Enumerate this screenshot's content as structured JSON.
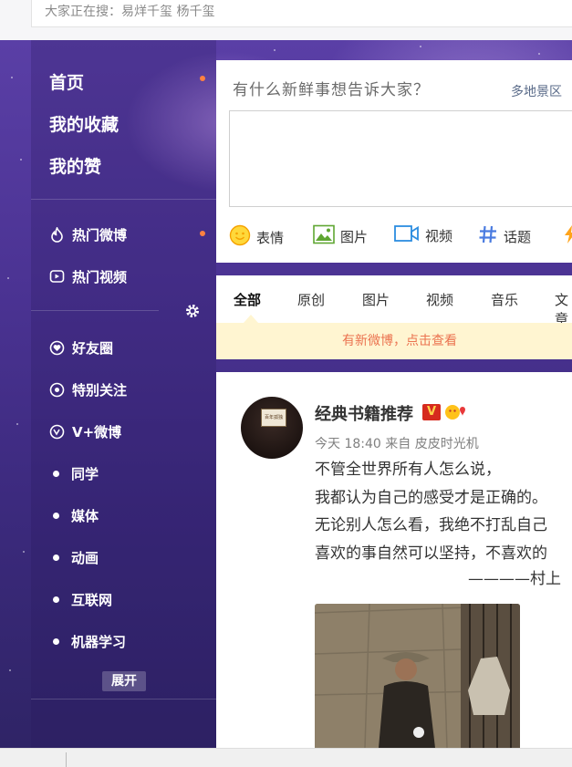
{
  "search": {
    "hot_text": "大家正在搜：易烊千玺 杨千玺"
  },
  "nav": {
    "main": [
      {
        "label": "首页",
        "dot": true
      },
      {
        "label": "我的收藏"
      },
      {
        "label": "我的赞"
      }
    ],
    "hot": [
      {
        "label": "热门微博",
        "icon": "flame-icon",
        "dot": true
      },
      {
        "label": "热门视频",
        "icon": "video-play-icon"
      }
    ],
    "groups": [
      {
        "label": "好友圈",
        "icon": "heart-circle-icon"
      },
      {
        "label": "特别关注",
        "icon": "eye-circle-icon"
      },
      {
        "label": "V+微博",
        "icon": "vplus-icon"
      },
      {
        "label": "同学",
        "icon": "bullet-icon"
      },
      {
        "label": "媒体",
        "icon": "bullet-icon"
      },
      {
        "label": "动画",
        "icon": "bullet-icon"
      },
      {
        "label": "互联网",
        "icon": "bullet-icon"
      },
      {
        "label": "机器学习",
        "icon": "bullet-icon"
      }
    ],
    "expand_label": "展开"
  },
  "composer": {
    "prompt": "有什么新鲜事想告诉大家？",
    "region": "多地景区",
    "tools": [
      {
        "label": "表情",
        "icon": "smiley-icon"
      },
      {
        "label": "图片",
        "icon": "image-icon"
      },
      {
        "label": "视频",
        "icon": "video-camera-icon"
      },
      {
        "label": "话题",
        "icon": "hashtag-icon"
      }
    ]
  },
  "tabs": [
    "全部",
    "原创",
    "图片",
    "视频",
    "音乐",
    "文章"
  ],
  "active_tab": "全部",
  "new_posts_notice": "有新微博，点击查看",
  "post": {
    "author": "经典书籍推荐",
    "verified_badge": "V",
    "time": "今天 18:40",
    "source_prefix": "来自",
    "source": "皮皮时光机",
    "avatar_label": "百年孤独",
    "lines": [
      "不管全世界所有人怎么说，",
      "我都认为自己的感受才是正确的。",
      "无论别人怎么看，我绝不打乱自己",
      "喜欢的事自然可以坚持，不喜欢的"
    ],
    "signature": "————村上"
  },
  "colors": {
    "accent_orange": "#ff8140",
    "link_blue": "#5a6b89",
    "notice_bg": "#fff5d1",
    "notice_text": "#eb7350"
  }
}
